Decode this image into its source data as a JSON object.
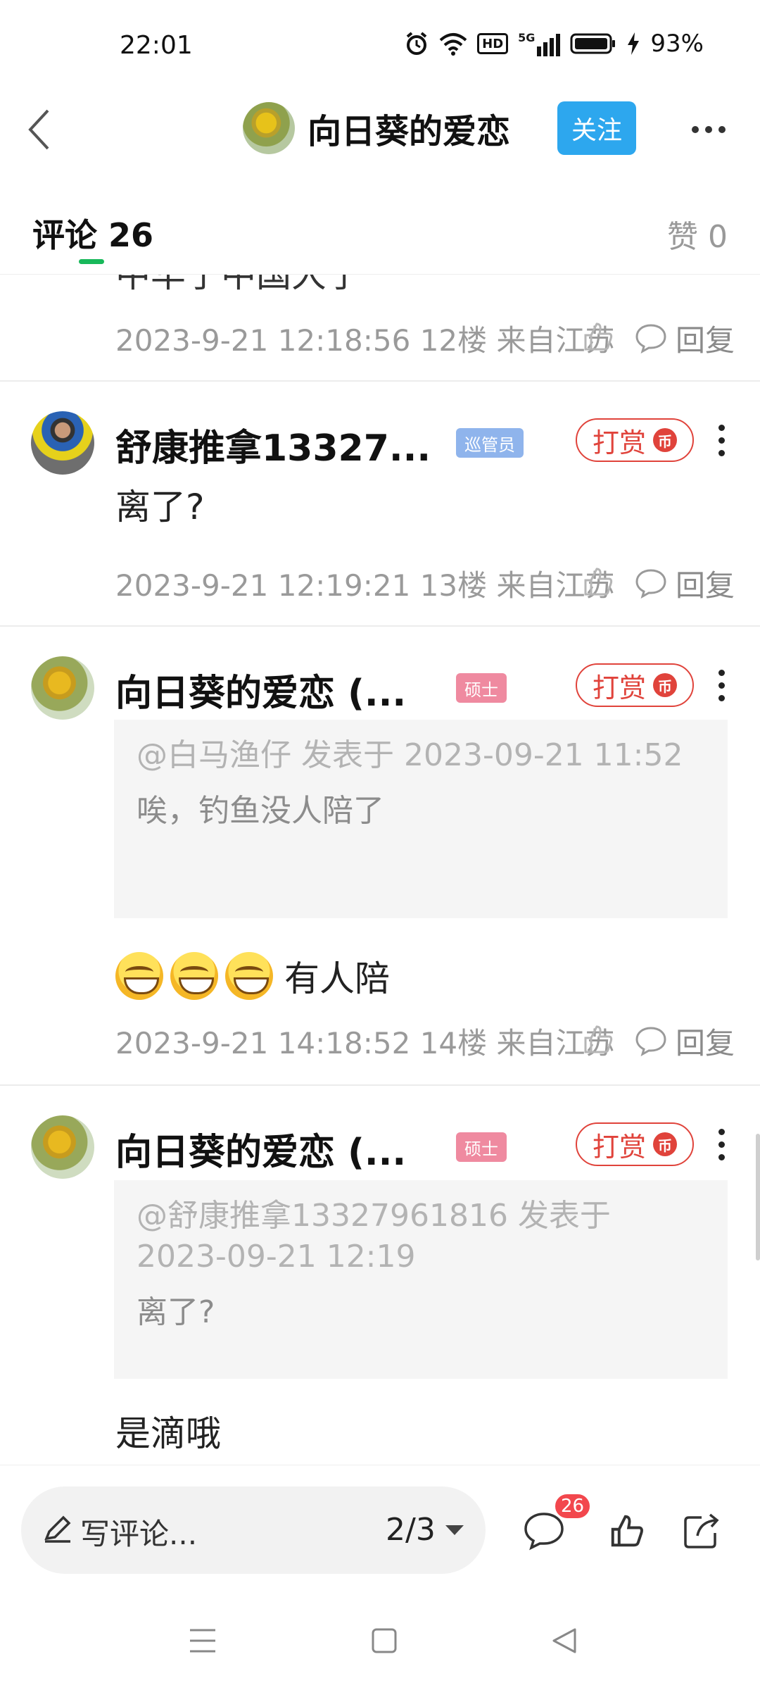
{
  "status_bar": {
    "time": "22:01",
    "battery_pct": "93%",
    "network": "5G",
    "hd": "HD"
  },
  "header": {
    "title": "向日葵的爱恋",
    "follow_label": "关注"
  },
  "tabs": {
    "comments_label": "评论",
    "comments_count": "26",
    "likes_label": "赞",
    "likes_count": "0"
  },
  "partial_text": "中华了中国大了",
  "comments": [
    {
      "meta": "2023-9-21 12:18:56  12楼  来自江苏",
      "reply_label": "回复"
    },
    {
      "username": "舒康推拿13327...",
      "badge": "巡管员",
      "tip_label": "打赏",
      "tip_coin": "币",
      "text": "离了?",
      "meta": "2023-9-21 12:19:21  13楼  来自江苏",
      "reply_label": "回复"
    },
    {
      "username": "向日葵的爱恋 (...",
      "badge": "硕士",
      "tip_label": "打赏",
      "tip_coin": "币",
      "quote_meta": "@白马渔仔 发表于 2023-09-21 11:52",
      "quote_text": "唉，钓鱼没人陪了",
      "text": "有人陪",
      "meta": "2023-9-21 14:18:52  14楼  来自江苏",
      "reply_label": "回复"
    },
    {
      "username": "向日葵的爱恋 (...",
      "badge": "硕士",
      "tip_label": "打赏",
      "tip_coin": "币",
      "quote_meta": "@舒康推拿13327961816 发表于 2023-09-21 12:19",
      "quote_text": "离了?",
      "text": "是滴哦"
    }
  ],
  "bottom_bar": {
    "input_placeholder": "写评论...",
    "page_indicator": "2/3",
    "comment_count_badge": "26"
  },
  "colors": {
    "accent_blue": "#2da7ee",
    "tip_red": "#e0433b",
    "tab_green": "#18b85a",
    "badge_blue": "#8fb4ec",
    "badge_pink": "#ef8aa0"
  }
}
